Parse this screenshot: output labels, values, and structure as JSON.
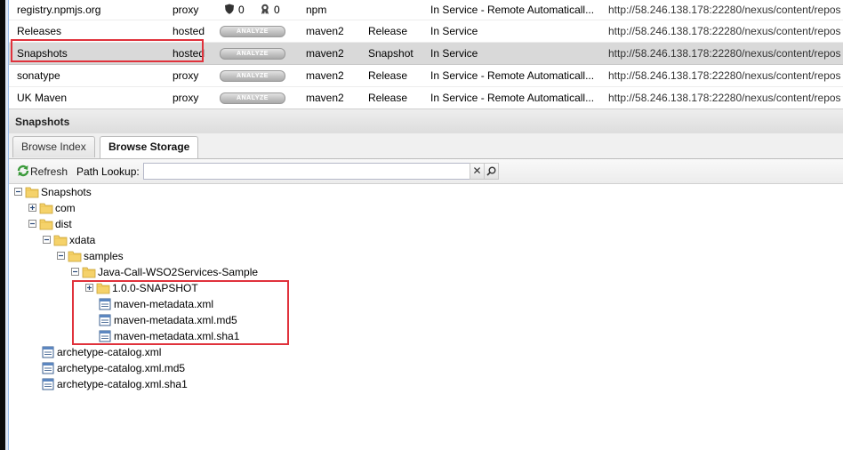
{
  "repositories": [
    {
      "name": "registry.npmjs.org",
      "type": "proxy",
      "health_security": "0",
      "health_license": "0",
      "format": "npm",
      "policy": "",
      "status": "In Service - Remote Automaticall...",
      "url": "http://58.246.138.178:22280/nexus/content/repos"
    },
    {
      "name": "Releases",
      "type": "hosted",
      "analyze_label": "ANALYZE",
      "format": "maven2",
      "policy": "Release",
      "status": "In Service",
      "url": "http://58.246.138.178:22280/nexus/content/repos"
    },
    {
      "name": "Snapshots",
      "type": "hosted",
      "analyze_label": "ANALYZE",
      "format": "maven2",
      "policy": "Snapshot",
      "status": "In Service",
      "url": "http://58.246.138.178:22280/nexus/content/repos"
    },
    {
      "name": "sonatype",
      "type": "proxy",
      "analyze_label": "ANALYZE",
      "format": "maven2",
      "policy": "Release",
      "status": "In Service - Remote Automaticall...",
      "url": "http://58.246.138.178:22280/nexus/content/repos"
    },
    {
      "name": "UK Maven",
      "type": "proxy",
      "analyze_label": "ANALYZE",
      "format": "maven2",
      "policy": "Release",
      "status": "In Service - Remote Automaticall...",
      "url": "http://58.246.138.178:22280/nexus/content/repos"
    }
  ],
  "panel": {
    "title": "Snapshots",
    "tabs": [
      {
        "label": "Browse Index"
      },
      {
        "label": "Browse Storage",
        "active": true
      }
    ],
    "toolbar": {
      "refresh_label": "Refresh",
      "path_lookup_label": "Path Lookup:",
      "path_value": ""
    }
  },
  "tree": [
    {
      "label": "Snapshots",
      "kind": "folder",
      "state": "expanded"
    },
    {
      "label": "com",
      "kind": "folder",
      "state": "collapsed"
    },
    {
      "label": "dist",
      "kind": "folder",
      "state": "expanded"
    },
    {
      "label": "xdata",
      "kind": "folder",
      "state": "expanded"
    },
    {
      "label": "samples",
      "kind": "folder",
      "state": "expanded"
    },
    {
      "label": "Java-Call-WSO2Services-Sample",
      "kind": "folder",
      "state": "expanded"
    },
    {
      "label": "1.0.0-SNAPSHOT",
      "kind": "folder",
      "state": "collapsed"
    },
    {
      "label": "maven-metadata.xml",
      "kind": "file"
    },
    {
      "label": "maven-metadata.xml.md5",
      "kind": "file"
    },
    {
      "label": "maven-metadata.xml.sha1",
      "kind": "file"
    },
    {
      "label": "archetype-catalog.xml",
      "kind": "file"
    },
    {
      "label": "archetype-catalog.xml.md5",
      "kind": "file"
    },
    {
      "label": "archetype-catalog.xml.sha1",
      "kind": "file"
    }
  ],
  "colors": {
    "highlight": "#e0323c",
    "selected_row": "#d9d9d9",
    "folder": "#f5d26a"
  }
}
